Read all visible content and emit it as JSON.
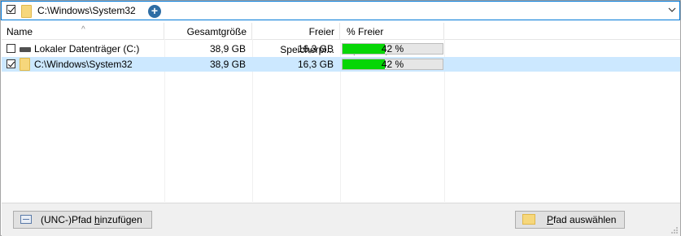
{
  "pathbar": {
    "checked": true,
    "path": "C:\\Windows\\System32",
    "add_icon": "plus-circle-icon",
    "dropdown_icon": "chevron-down-icon"
  },
  "columns": [
    "Name",
    "Gesamtgröße",
    "Freier Speicherpl...",
    "% Freier Speicherplatz"
  ],
  "rows": [
    {
      "checked": false,
      "icon": "drive-icon",
      "name": "Lokaler Datenträger (C:)",
      "total": "38,9 GB",
      "free": "16,3 GB",
      "percent_free": 42,
      "percent_label": "42 %",
      "selected": false
    },
    {
      "checked": true,
      "icon": "folder-icon",
      "name": "C:\\Windows\\System32",
      "total": "38,9 GB",
      "free": "16,3 GB",
      "percent_free": 42,
      "percent_label": "42 %",
      "selected": true
    }
  ],
  "buttons": {
    "add_unc_pre": "(UNC-)Pfad ",
    "add_unc_u": "h",
    "add_unc_post": "inzufügen",
    "choose_u": "P",
    "choose_post": "fad auswählen"
  },
  "colors": {
    "selection": "#cce8ff",
    "bar_fill": "#06d606",
    "focus_border": "#0078d7"
  }
}
